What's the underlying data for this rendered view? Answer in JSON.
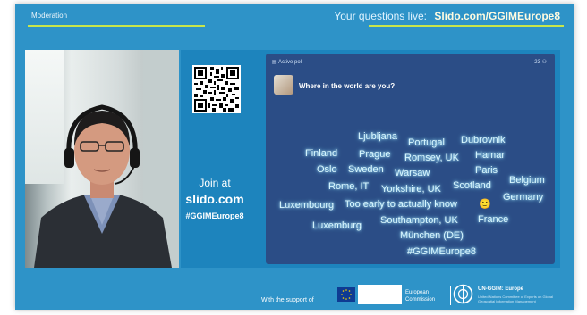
{
  "header": {
    "left_label": "Moderation",
    "prefix": "Your questions live:",
    "url": "Slido.com/GGIMEurope8"
  },
  "join": {
    "label": "Join at",
    "domain": "slido.com",
    "hashtag": "#GGIMEurope8"
  },
  "poll": {
    "header": "Active poll",
    "count": "23",
    "question": "Where in the world are you?",
    "words": [
      "Ljubljana",
      "Portugal",
      "Dubrovnik",
      "Finland",
      "Prague",
      "Romsey, UK",
      "Hamar",
      "Oslo",
      "Sweden",
      "Warsaw",
      "Paris",
      "Belgium",
      "Rome, IT",
      "Yorkshire, UK",
      "Scotland",
      "Germany",
      "Luxembourg",
      "Too early to actually know",
      "🙂",
      "Luxemburg",
      "Southampton, UK",
      "France",
      "München (DE)",
      "#GGIMEurope8"
    ]
  },
  "footer": {
    "support_label": "With the support of",
    "eu_name": "European Commission",
    "un_title": "UN-GGIM: Europe",
    "un_sub": "United Nations Committee of Experts on Global Geospatial Information Management"
  },
  "colors": {
    "background": "#2e93c8",
    "panel": "#1d84bd",
    "poll": "#2b4d86",
    "accent_line": "#c8e64b"
  },
  "icons": [
    "qr-code-icon",
    "eu-flag-icon",
    "un-ggim-logo-icon",
    "poll-icon",
    "people-icon"
  ]
}
